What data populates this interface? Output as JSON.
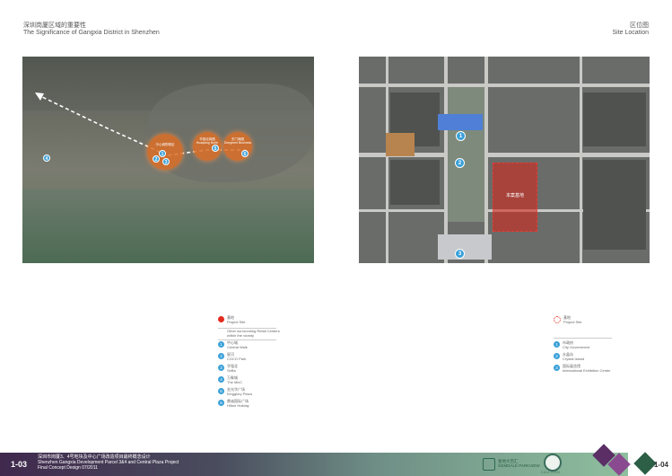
{
  "header_left": {
    "zh": "深圳岗厦区域的重要性",
    "en": "The Significance of Gangxia District in Shenzhen"
  },
  "header_right": {
    "zh": "区位图",
    "en": "Site Location"
  },
  "left_map": {
    "circles": [
      {
        "zh": "中心城购物区",
        "en": ""
      },
      {
        "zh": "华强北商圈",
        "en": "Huaqiang North"
      },
      {
        "zh": "东门商圈",
        "en": "Dongmen Business"
      }
    ],
    "pins": [
      "1",
      "2",
      "3",
      "4",
      "5",
      "6"
    ]
  },
  "right_map": {
    "project_label": "本案基地",
    "pins": [
      "1",
      "2",
      "3"
    ]
  },
  "legend_left": {
    "project": {
      "zh": "基地",
      "en": "Project Site"
    },
    "note": "Other surrounding Retail Centers within the vicinity",
    "items": [
      {
        "num": "1",
        "zh": "中心城",
        "en": "Central Walk"
      },
      {
        "num": "2",
        "zh": "星河",
        "en": "COCO Park"
      },
      {
        "num": "3",
        "zh": "华强北",
        "en": "SeBa"
      },
      {
        "num": "4",
        "zh": "万象城",
        "en": "The MixC"
      },
      {
        "num": "5",
        "zh": "金光华广场",
        "en": "Kingglory Plaza"
      },
      {
        "num": "6",
        "zh": "鼎诚国际广场",
        "en": "Hilton Holiday"
      }
    ]
  },
  "legend_right": {
    "project": {
      "zh": "基地",
      "en": "Project Site"
    },
    "items": [
      {
        "num": "1",
        "zh": "市政府",
        "en": "City Government"
      },
      {
        "num": "2",
        "zh": "水晶岛",
        "en": "Crystal Island"
      },
      {
        "num": "3",
        "zh": "国际展览馆",
        "en": "International Exhibition Center"
      }
    ]
  },
  "footer": {
    "page_left": "1-03",
    "line1": "深圳市岗厦3、4号地块及中心广场改造项目最终概念设计",
    "line2": "Shenzhen Gangxia  Development Parcel 3&4 and Central Plaza Project",
    "line3": "Final Concept Design 07/2011",
    "logo1_zh": "金地大百汇",
    "logo1_en": "GEMDALE PARKVIEW",
    "logo2": "CALLISON",
    "page_right": "1-04"
  },
  "colors": {
    "accent_blue": "#3aa0d8",
    "project_red": "#e52b1f",
    "footer_purple": "#40294d",
    "footer_green": "#8fbf9e"
  }
}
